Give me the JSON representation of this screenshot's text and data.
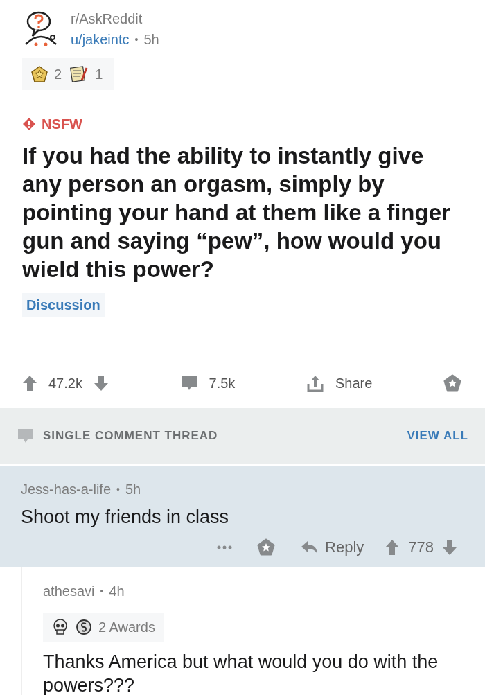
{
  "post": {
    "subreddit": "r/AskReddit",
    "author": "u/jakeintc",
    "separator": "•",
    "age": "5h",
    "awards": [
      {
        "kind": "gold",
        "count": "2"
      },
      {
        "kind": "notes",
        "count": "1"
      }
    ],
    "nsfw_label": "NSFW",
    "title": "If you had the ability to instantly give any person an orgasm, simply by pointing your hand at them like a finger gun and saying “pew”, how would you wield this power?",
    "flair": "Discussion",
    "score": "47.2k",
    "comments": "7.5k",
    "share": "Share"
  },
  "thread_bar": {
    "label": "SINGLE COMMENT THREAD",
    "view_all": "VIEW ALL"
  },
  "comments": [
    {
      "author": "Jess-has-a-life",
      "separator": "•",
      "age": "5h",
      "body": "Shoot my friends in class",
      "highlighted": true,
      "reply": "Reply",
      "score": "778"
    },
    {
      "author": "athesavi",
      "separator": "•",
      "age": "4h",
      "awards_label": "2 Awards",
      "body": "Thanks America but what would you do with the powers???",
      "highlighted": false
    }
  ]
}
